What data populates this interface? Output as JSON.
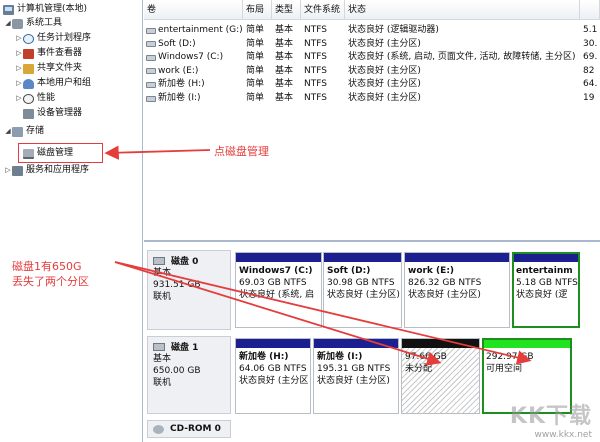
{
  "tree": {
    "root": "计算机管理(本地)",
    "system_tools": "系统工具",
    "task_scheduler": "任务计划程序",
    "event_viewer": "事件查看器",
    "shared_folders": "共享文件夹",
    "local_users": "本地用户和组",
    "performance": "性能",
    "device_manager": "设备管理器",
    "storage": "存储",
    "disk_management": "磁盘管理",
    "services_apps": "服务和应用程序"
  },
  "volume_list": {
    "headers": [
      "卷",
      "布局",
      "类型",
      "文件系统",
      "状态",
      ""
    ],
    "rows": [
      {
        "name": "entertainment (G:)",
        "layout": "简单",
        "type": "基本",
        "fs": "NTFS",
        "status": "状态良好 (逻辑驱动器)",
        "cap": "5.1"
      },
      {
        "name": "Soft (D:)",
        "layout": "简单",
        "type": "基本",
        "fs": "NTFS",
        "status": "状态良好 (主分区)",
        "cap": "30."
      },
      {
        "name": "Windows7 (C:)",
        "layout": "简单",
        "type": "基本",
        "fs": "NTFS",
        "status": "状态良好 (系统, 启动, 页面文件, 活动, 故障转储, 主分区)",
        "cap": "69."
      },
      {
        "name": "work (E:)",
        "layout": "简单",
        "type": "基本",
        "fs": "NTFS",
        "status": "状态良好 (主分区)",
        "cap": "82"
      },
      {
        "name": "新加卷 (H:)",
        "layout": "简单",
        "type": "基本",
        "fs": "NTFS",
        "status": "状态良好 (主分区)",
        "cap": "64."
      },
      {
        "name": "新加卷 (I:)",
        "layout": "简单",
        "type": "基本",
        "fs": "NTFS",
        "status": "状态良好 (主分区)",
        "cap": "19"
      }
    ]
  },
  "disks": [
    {
      "name": "磁盘 0",
      "type": "基本",
      "size": "931.51 GB",
      "state": "联机",
      "partitions": [
        {
          "name": "Windows7 (C:)",
          "size": "69.03 GB NTFS",
          "status": "状态良好 (系统, 启"
        },
        {
          "name": "Soft (D:)",
          "size": "30.98 GB NTFS",
          "status": "状态良好 (主分区)"
        },
        {
          "name": "work (E:)",
          "size": "826.32 GB NTFS",
          "status": "状态良好 (主分区)"
        },
        {
          "name": "entertainm",
          "size": "5.18 GB NTFS",
          "status": "状态良好 (逻"
        }
      ]
    },
    {
      "name": "磁盘 1",
      "type": "基本",
      "size": "650.00 GB",
      "state": "联机",
      "partitions": [
        {
          "name": "新加卷 (H:)",
          "size": "64.06 GB NTFS",
          "status": "状态良好 (主分区"
        },
        {
          "name": "新加卷 (I:)",
          "size": "195.31 GB NTFS",
          "status": "状态良好 (主分区)"
        },
        {
          "name": "",
          "size": "97.66 GB",
          "status": "未分配"
        },
        {
          "name": "",
          "size": "292.97 GB",
          "status": "可用空间"
        }
      ]
    }
  ],
  "cdrom": "CD-ROM 0",
  "annotations": {
    "click_disk_mgmt": "点磁盘管理",
    "disk_note_line1": "磁盘1有650G",
    "disk_note_line2": "丢失了两个分区",
    "color": "#e53c3c"
  },
  "watermark": {
    "logo": "KK下载",
    "url": "www.kkx.net"
  },
  "colors": {
    "primary_partition_bar": "#1b1f8f",
    "unallocated_bar": "#111111",
    "free_space_bar": "#22e31f",
    "selection_outline": "#1e8f1e"
  }
}
